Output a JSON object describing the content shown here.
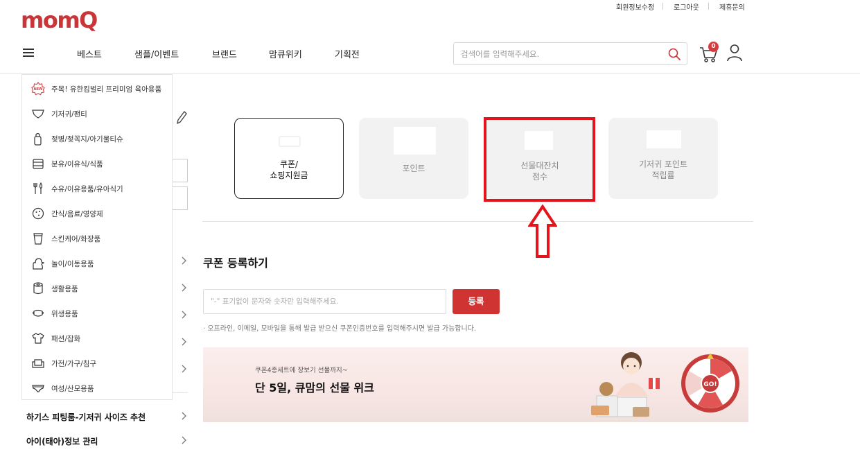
{
  "util_links": [
    "회원정보수정",
    "로그아웃",
    "제휴문의"
  ],
  "logo": "momQ",
  "nav": [
    "베스트",
    "샘플/이벤트",
    "브랜드",
    "맘큐위키",
    "기획전"
  ],
  "search": {
    "placeholder": "검색어를 입력해주세요."
  },
  "cart": {
    "count": "0"
  },
  "menu": [
    {
      "label": "주목! 유한킴벌리 프리미엄 육아용품",
      "icon": "new-badge-icon"
    },
    {
      "label": "기저귀/팬티",
      "icon": "diaper-icon"
    },
    {
      "label": "젖병/젖꼭지/아기물티슈",
      "icon": "baby-bottle-icon"
    },
    {
      "label": "분유/이유식/식품",
      "icon": "formula-can-icon"
    },
    {
      "label": "수유/이유용품/유아식기",
      "icon": "utensils-icon"
    },
    {
      "label": "간식/음료/영양제",
      "icon": "cookie-icon"
    },
    {
      "label": "스킨케어/화장품",
      "icon": "cup-icon"
    },
    {
      "label": "놀이/이동용품",
      "icon": "duck-toy-icon"
    },
    {
      "label": "생활용품",
      "icon": "tissue-roll-icon"
    },
    {
      "label": "위생용품",
      "icon": "mask-icon"
    },
    {
      "label": "패션/잡화",
      "icon": "shirt-icon"
    },
    {
      "label": "가전/가구/침구",
      "icon": "sofa-icon"
    },
    {
      "label": "여성/산모용품",
      "icon": "underwear-icon"
    }
  ],
  "side_links": [
    "하기스 피팅룸-기저귀 사이즈 추천",
    "아이(태아)정보 관리"
  ],
  "cards": [
    {
      "label": [
        "쿠폰/",
        "쇼핑지원금"
      ]
    },
    {
      "label": [
        "포인트"
      ]
    },
    {
      "label": [
        "선물대잔치",
        "점수"
      ]
    },
    {
      "label": [
        "기저귀 포인트",
        "적립률"
      ]
    }
  ],
  "coupon": {
    "title": "쿠폰 등록하기",
    "placeholder": "\"-\" 표기없이 문자와 숫자만 입력해주세요.",
    "button": "등록",
    "notice": "· 오프라인, 이메일, 모바일을 통해 발급 받으신 쿠폰인증번호를 입력해주시면 발급 가능합니다."
  },
  "banner": {
    "subtitle": "쿠폰4종세트에 장보기 선물까지~",
    "title": "단 5일, 큐맘의 선물 위크",
    "roulette_text": "GO!"
  },
  "colors": {
    "brand": "#c8363a",
    "accent_red": "#cf3433",
    "highlight": "#e3141c"
  }
}
